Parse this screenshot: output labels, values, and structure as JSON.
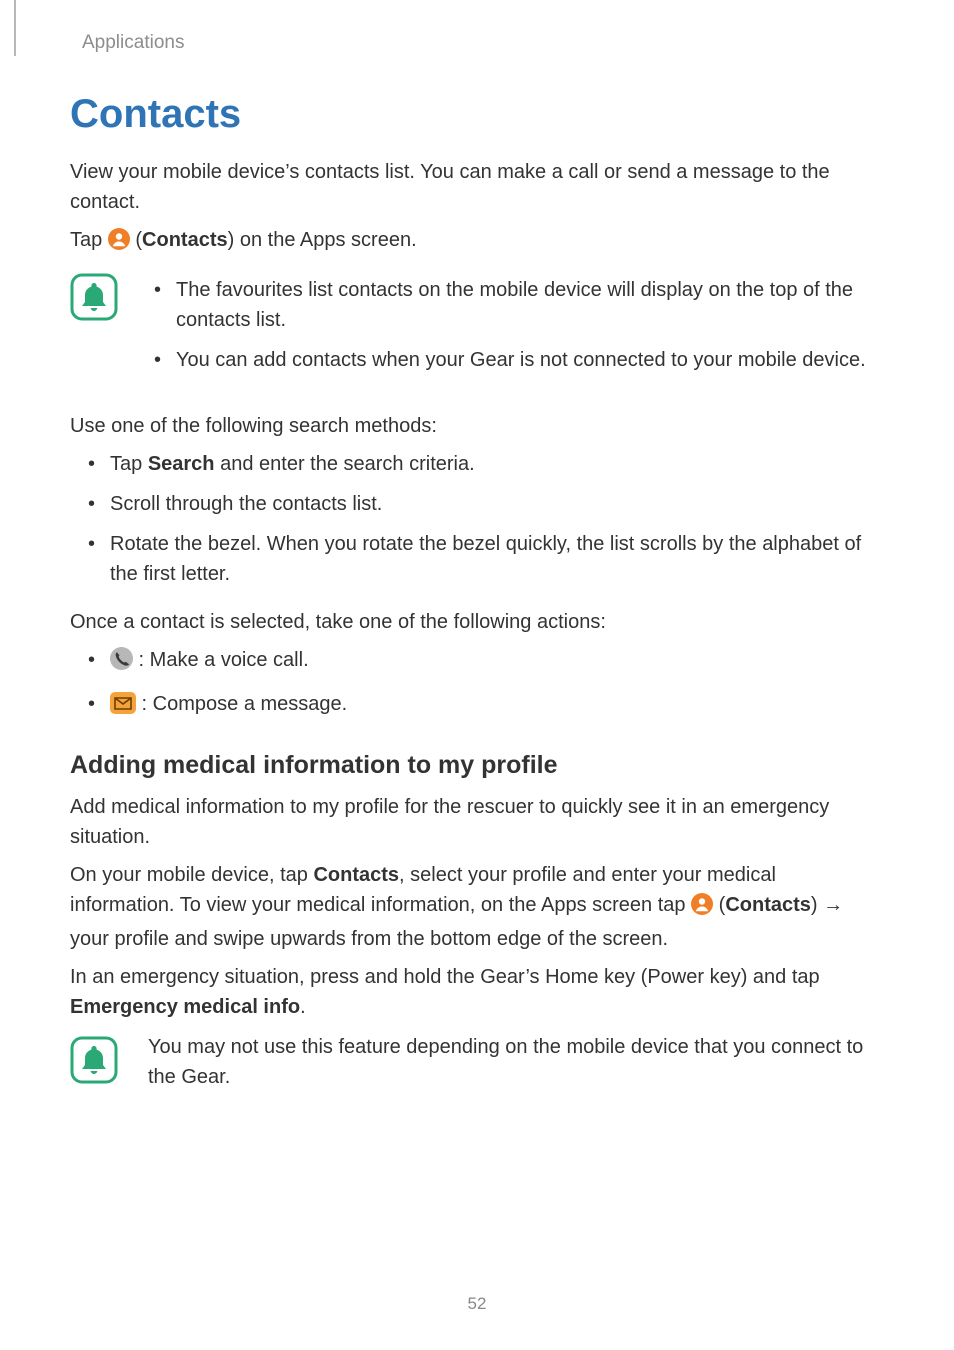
{
  "header": {
    "section": "Applications"
  },
  "title": "Contacts",
  "intro": "View your mobile device’s contacts list. You can make a call or send a message to the contact.",
  "tap_line": {
    "pre": "Tap ",
    "label": "Contacts",
    "post": ") on the Apps screen."
  },
  "note1": {
    "items": [
      "The favourites list contacts on the mobile device will display on the top of the contacts list.",
      "You can add contacts when your Gear is not connected to your mobile device."
    ]
  },
  "search_intro": "Use one of the following search methods:",
  "search_methods": {
    "item1_pre": "Tap ",
    "item1_bold": "Search",
    "item1_post": " and enter the search criteria.",
    "item2": "Scroll through the contacts list.",
    "item3": "Rotate the bezel. When you rotate the bezel quickly, the list scrolls by the alphabet of the first letter."
  },
  "actions_intro": "Once a contact is selected, take one of the following actions:",
  "actions": {
    "call": " : Make a voice call.",
    "message": " : Compose a message."
  },
  "subhead": "Adding medical information to my profile",
  "med_p1": "Add medical information to my profile for the rescuer to quickly see it in an emergency situation.",
  "med_p2": {
    "a": "On your mobile device, tap ",
    "b": "Contacts",
    "c": ", select your profile and enter your medical information. To view your medical information, on the Apps screen tap ",
    "d": "Contacts",
    "e": ") ",
    "arrow": "→",
    "f": " your profile and swipe upwards from the bottom edge of the screen."
  },
  "med_p3": {
    "a": "In an emergency situation, press and hold the Gear’s Home key (Power key) and tap ",
    "b": "Emergency medical info",
    "c": "."
  },
  "note2": "You may not use this feature depending on the mobile device that you connect to the Gear.",
  "page_number": "52",
  "icons": {
    "contacts": "contacts-icon",
    "bell": "bell-note-icon",
    "phone": "phone-icon",
    "envelope": "envelope-icon"
  }
}
